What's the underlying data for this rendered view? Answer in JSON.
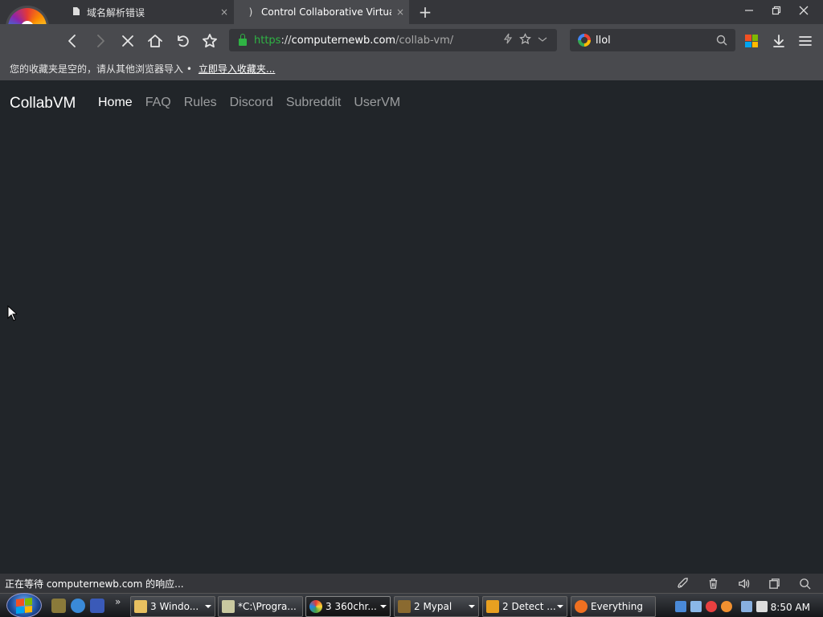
{
  "browser": {
    "tabs": [
      {
        "title": "域名解析错误",
        "close": "×"
      },
      {
        "title": "Control Collaborative Virtual Machines!",
        "close": "×"
      }
    ],
    "new_tab": "+",
    "address": {
      "scheme": "https",
      "sep": "://",
      "host": "computernewb.com",
      "path": "/collab-vm/"
    },
    "search": {
      "query": "llol"
    },
    "bookmarks_bar": {
      "message": "您的收藏夹是空的，请从其他浏览器导入 •",
      "import_link": "立即导入收藏夹..."
    },
    "status_text": "正在等待 computernewb.com 的响应..."
  },
  "page": {
    "brand": "CollabVM",
    "nav": [
      "Home",
      "FAQ",
      "Rules",
      "Discord",
      "Subreddit",
      "UserVM"
    ],
    "active_nav": "Home"
  },
  "taskbar": {
    "tasks": [
      {
        "label": "3 Windo...",
        "icon_color": "#e8c060"
      },
      {
        "label": "*C:\\Progra...",
        "icon_color": "#c9c9a0"
      },
      {
        "label": "3 360chr...",
        "icon_color": "#4a9ff5"
      },
      {
        "label": "2 Mypal",
        "icon_color": "#8a6a30"
      },
      {
        "label": "2 Detect ...",
        "icon_color": "#e8a020"
      },
      {
        "label": "Everything",
        "icon_color": "#f07020"
      }
    ],
    "clock": "8:50 AM"
  },
  "colors": {
    "page_bg": "#212529",
    "chrome_dark": "#35363a",
    "chrome_light": "#494a4e",
    "secure_green": "#2fb344"
  }
}
